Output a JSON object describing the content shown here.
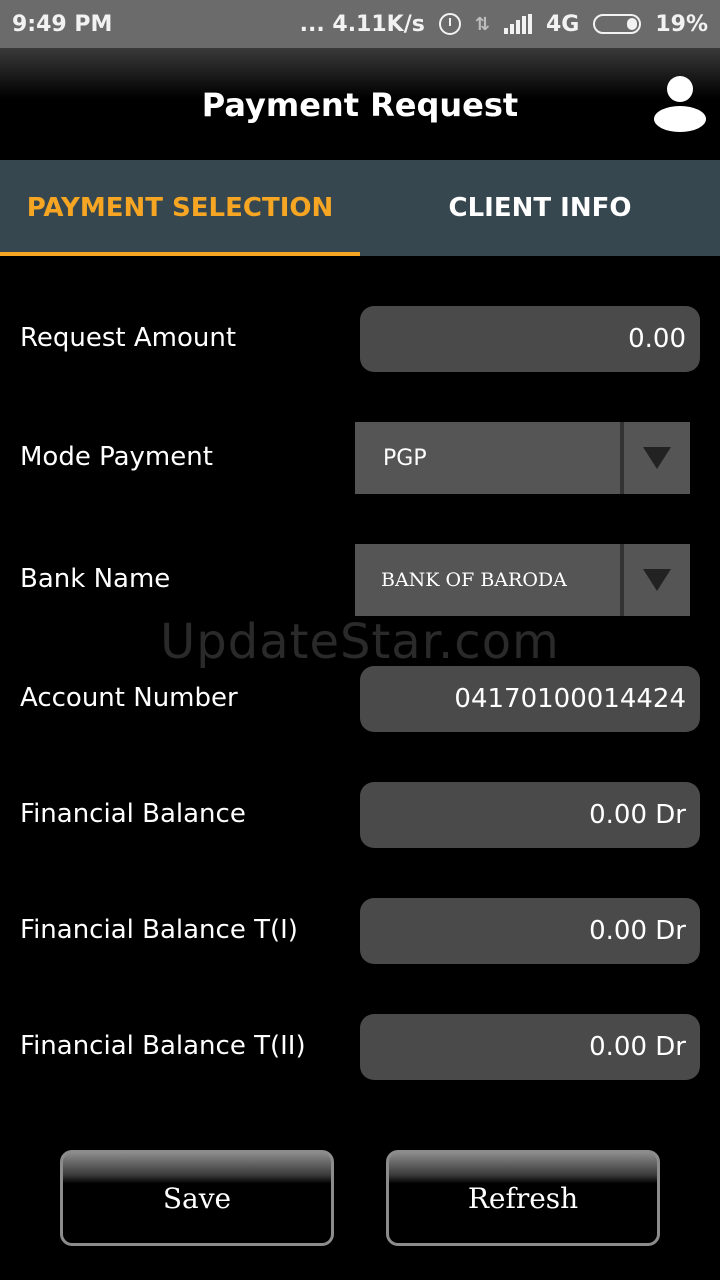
{
  "status_bar": {
    "time": "9:49 PM",
    "speed": "... 4.11K/s",
    "network": "4G",
    "battery": "19%",
    "icons": [
      "alarm-icon",
      "data-transfer-icon",
      "signal-icon",
      "battery-icon"
    ]
  },
  "header": {
    "title": "Payment Request",
    "user_icon": "user-profile-icon"
  },
  "tabs": [
    {
      "label": "PAYMENT SELECTION",
      "active": true
    },
    {
      "label": "CLIENT INFO",
      "active": false
    }
  ],
  "form": {
    "request_amount": {
      "label": "Request Amount",
      "value": "0.00"
    },
    "mode_payment": {
      "label": "Mode Payment",
      "value": "PGP"
    },
    "bank_name": {
      "label": "Bank Name",
      "value": "BANK OF BARODA"
    },
    "account_number": {
      "label": "Account Number",
      "value": "04170100014424"
    },
    "financial_balance": {
      "label": "Financial Balance",
      "value": "0.00 Dr"
    },
    "financial_balance_t1": {
      "label": "Financial Balance T(I)",
      "value": "0.00 Dr"
    },
    "financial_balance_t2": {
      "label": "Financial Balance T(II)",
      "value": "0.00 Dr"
    }
  },
  "watermark": "UpdateStar.com",
  "buttons": {
    "save": "Save",
    "refresh": "Refresh"
  },
  "colors": {
    "accent": "#f6a623",
    "tab_bar": "#37474f",
    "field_bg": "#4a4a4a"
  }
}
